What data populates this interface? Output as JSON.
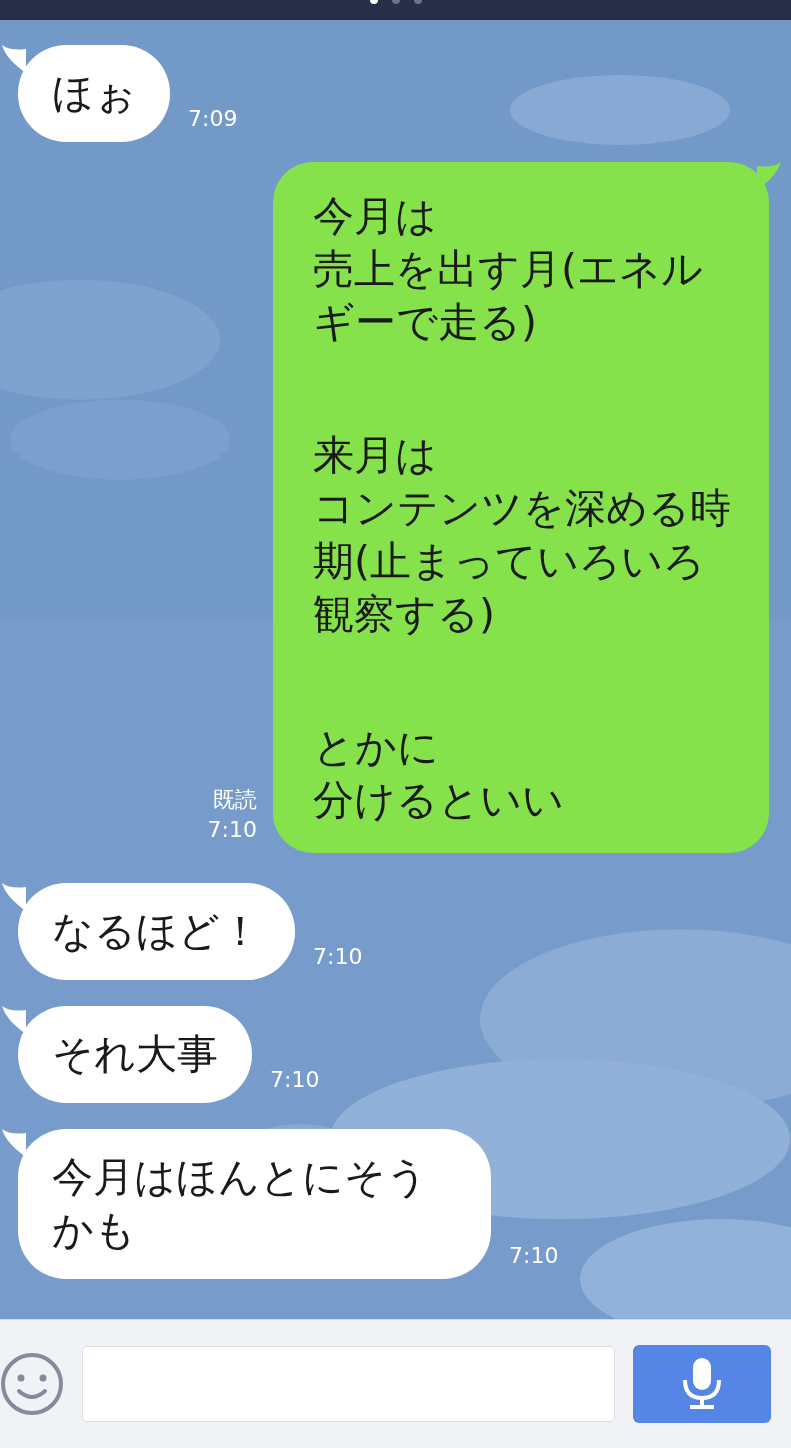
{
  "messages": [
    {
      "kind": "incoming",
      "text": "ほぉ",
      "time": "7:09"
    },
    {
      "kind": "outgoing",
      "paragraphs": [
        [
          "今月は",
          "売上を出す月(エネルギーで走る)"
        ],
        [
          "来月は",
          "コンテンツを深める時期(止まっていろいろ観察する)"
        ],
        [
          "とかに",
          "分けるといい"
        ]
      ],
      "read": "既読",
      "time": "7:10"
    },
    {
      "kind": "incoming",
      "text": "なるほど！",
      "time": "7:10"
    },
    {
      "kind": "incoming",
      "text": "それ大事",
      "time": "7:10"
    },
    {
      "kind": "incoming",
      "text": "今月はほんとにそうかも",
      "time": "7:10"
    }
  ]
}
